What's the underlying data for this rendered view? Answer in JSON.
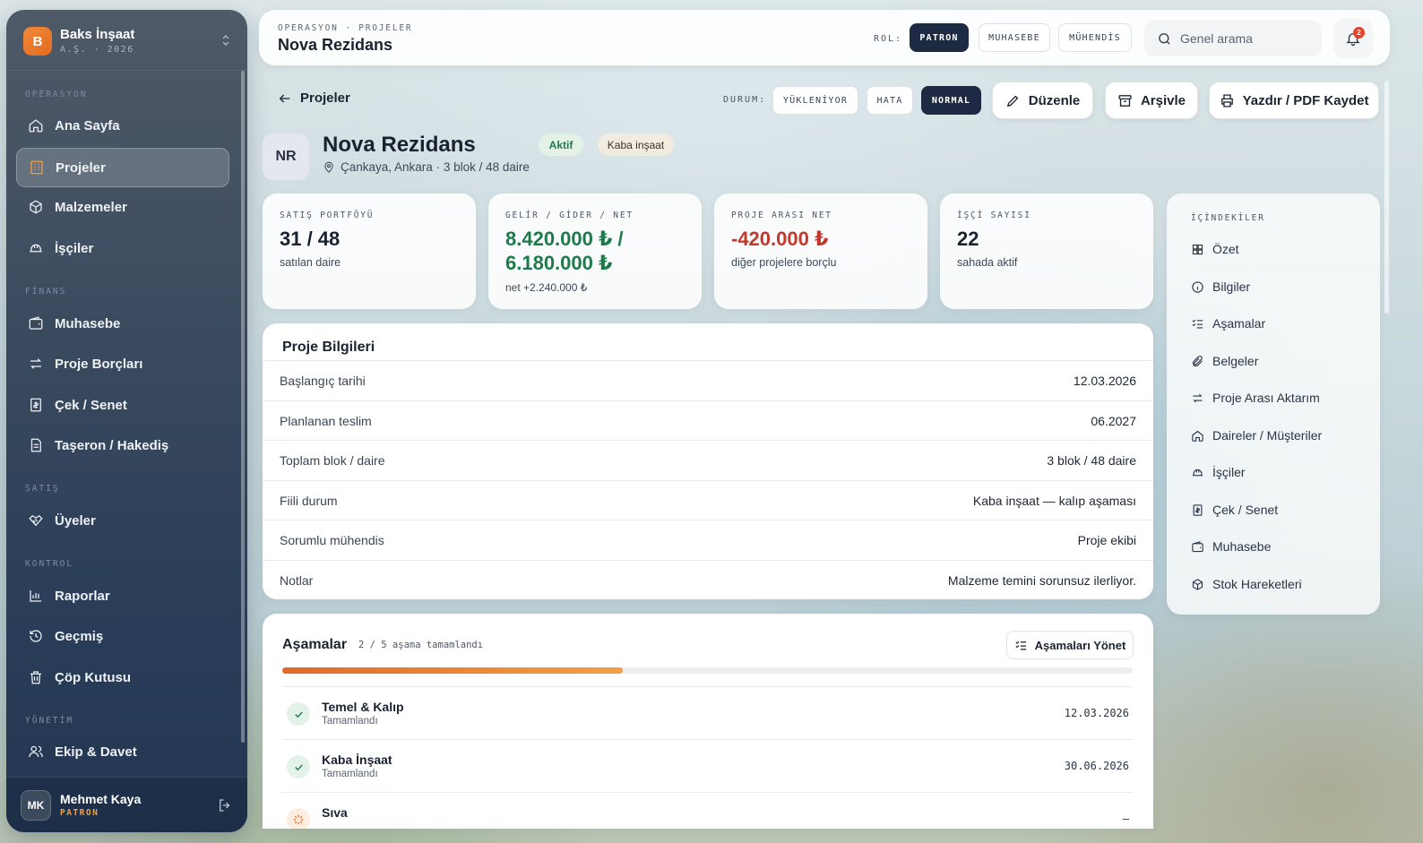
{
  "sidebar": {
    "brand_initial": "B",
    "brand_name": "Baks İnşaat",
    "brand_sub": "A.Ş. · 2026",
    "sections": {
      "operasyon": "OPERASYON",
      "finans": "FİNANS",
      "satis": "SATIŞ",
      "kontrol": "KONTROL",
      "yonetim": "YÖNETİM"
    },
    "items": {
      "ana_sayfa": "Ana Sayfa",
      "projeler": "Projeler",
      "malzemeler": "Malzemeler",
      "isciler": "İşçiler",
      "muhasebe": "Muhasebe",
      "proje_borclari": "Proje Borçları",
      "cek_senet": "Çek / Senet",
      "taseron": "Taşeron / Hakediş",
      "uyeler": "Üyeler",
      "raporlar": "Raporlar",
      "gecmis": "Geçmiş",
      "cop_kutusu": "Çöp Kutusu",
      "ekip_davet": "Ekip & Davet"
    },
    "active": "projeler",
    "user": {
      "initials": "MK",
      "name": "Mehmet Kaya",
      "role": "PATRON"
    }
  },
  "topbar": {
    "breadcrumb": "OPERASYON · PROJELER",
    "title": "Nova Rezidans",
    "role_label": "ROL:",
    "roles": [
      "PATRON",
      "MUHASEBE",
      "MÜHENDİS"
    ],
    "active_role": "PATRON",
    "search_placeholder": "Genel arama",
    "notification_count": "2"
  },
  "actions": {
    "back_label": "Projeler",
    "durum_label": "DURUM:",
    "durum_options": [
      "YÜKLENİYOR",
      "HATA",
      "NORMAL"
    ],
    "durum_active": "NORMAL",
    "edit": "Düzenle",
    "archive": "Arşivle",
    "print": "Yazdır / PDF Kaydet"
  },
  "project": {
    "initials": "NR",
    "name": "Nova Rezidans",
    "status_tag": "Aktif",
    "phase_tag": "Kaba inşaat",
    "location": "Çankaya, Ankara",
    "summary": "3 blok / 48 daire"
  },
  "cards": {
    "satis": {
      "label": "SATIŞ PORTFÖYÜ",
      "value": "31 / 48",
      "sub": "satılan daire"
    },
    "gelir": {
      "label": "GELİR / GİDER / NET",
      "value_line1": "8.420.000 ₺ /",
      "value_line2": "6.180.000 ₺",
      "sub": "net +2.240.000 ₺"
    },
    "proje_arasi": {
      "label": "PROJE ARASI NET",
      "value": "-420.000 ₺",
      "sub": "diğer projelere borçlu"
    },
    "isci": {
      "label": "İŞÇİ SAYISI",
      "value": "22",
      "sub": "sahada aktif"
    }
  },
  "info": {
    "title": "Proje Bilgileri",
    "rows": [
      {
        "key": "Başlangıç tarihi",
        "value": "12.03.2026"
      },
      {
        "key": "Planlanan teslim",
        "value": "06.2027"
      },
      {
        "key": "Toplam blok / daire",
        "value": "3 blok / 48 daire"
      },
      {
        "key": "Fiili durum",
        "value": "Kaba inşaat — kalıp aşaması"
      },
      {
        "key": "Sorumlu mühendis",
        "value": "Proje ekibi"
      },
      {
        "key": "Notlar",
        "value": "Malzeme temini sorunsuz ilerliyor."
      }
    ]
  },
  "stages": {
    "title": "Aşamalar",
    "count_text": "2 / 5 aşama tamamlandı",
    "manage_button": "Aşamaları Yönet",
    "progress": 0.4,
    "items": [
      {
        "name": "Temel & Kalıp",
        "status": "Tamamlandı",
        "date": "12.03.2026"
      },
      {
        "name": "Kaba İnşaat",
        "status": "Tamamlandı",
        "date": "30.06.2026"
      },
      {
        "name": "Sıva",
        "status": "",
        "date": "—"
      }
    ]
  },
  "toc": {
    "title": "İÇİNDEKİLER",
    "items": [
      "Özet",
      "Bilgiler",
      "Aşamalar",
      "Belgeler",
      "Proje Arası Aktarım",
      "Daireler / Müşteriler",
      "İşçiler",
      "Çek / Senet",
      "Muhasebe",
      "Stok Hareketleri"
    ]
  },
  "colors": {
    "accent": "#e36a1e",
    "dark": "#1e2a44",
    "positive": "#1e7a4a",
    "negative": "#c0392b"
  }
}
